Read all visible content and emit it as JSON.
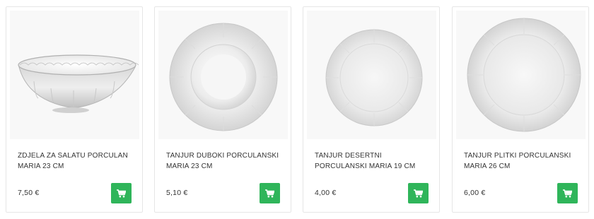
{
  "products": [
    {
      "title": "ZDJELA ZA SALATU PORCULAN MARIA 23 CM",
      "price": "7,50 €",
      "image": "bowl",
      "cart_icon": "cart-icon"
    },
    {
      "title": "TANJUR DUBOKI PORCULANSKI MARIA 23 CM",
      "price": "5,10 €",
      "image": "deep-plate",
      "cart_icon": "cart-icon"
    },
    {
      "title": "TANJUR DESERTNI PORCULANSKI MARIA 19 CM",
      "price": "4,00 €",
      "image": "dessert-plate",
      "cart_icon": "cart-icon"
    },
    {
      "title": "TANJUR PLITKI PORCULANSKI MARIA 26 CM",
      "price": "6,00 €",
      "image": "flat-plate",
      "cart_icon": "cart-icon"
    }
  ],
  "colors": {
    "accent": "#2fb55a",
    "text": "#333333",
    "border": "#e6e6e6"
  }
}
